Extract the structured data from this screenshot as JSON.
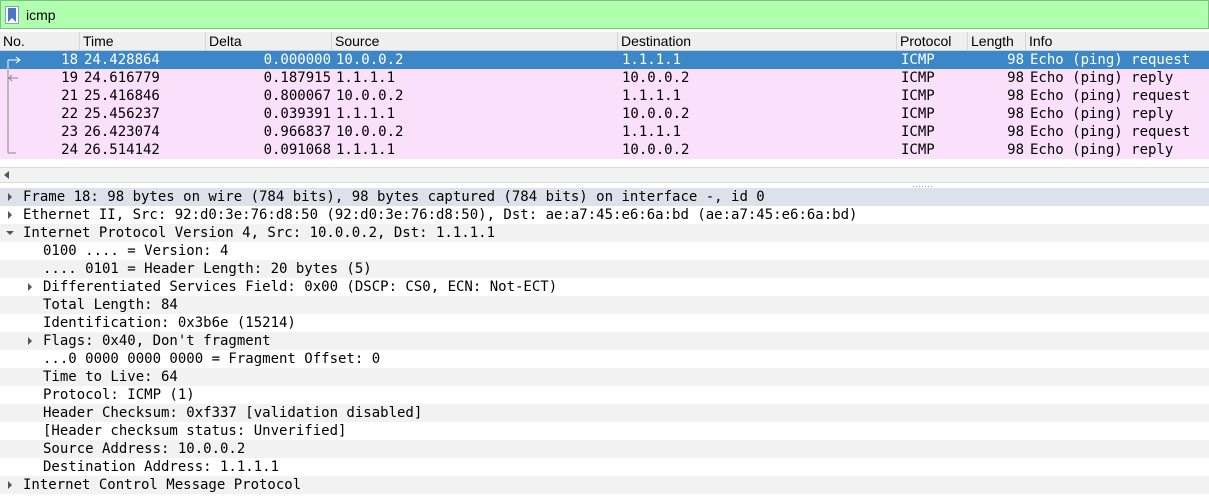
{
  "filter": {
    "value": "icmp",
    "background": "#afffaf"
  },
  "columns": [
    "No.",
    "Time",
    "Delta",
    "Source",
    "Destination",
    "Protocol",
    "Length",
    "Info"
  ],
  "packets": [
    {
      "no": "18",
      "time": "24.428864",
      "delta": "0.000000",
      "source": "10.0.0.2",
      "destination": "1.1.1.1",
      "protocol": "ICMP",
      "length": "98",
      "info": "Echo (ping) request"
    },
    {
      "no": "19",
      "time": "24.616779",
      "delta": "0.187915",
      "source": "1.1.1.1",
      "destination": "10.0.0.2",
      "protocol": "ICMP",
      "length": "98",
      "info": "Echo (ping) reply"
    },
    {
      "no": "21",
      "time": "25.416846",
      "delta": "0.800067",
      "source": "10.0.0.2",
      "destination": "1.1.1.1",
      "protocol": "ICMP",
      "length": "98",
      "info": "Echo (ping) request"
    },
    {
      "no": "22",
      "time": "25.456237",
      "delta": "0.039391",
      "source": "1.1.1.1",
      "destination": "10.0.0.2",
      "protocol": "ICMP",
      "length": "98",
      "info": "Echo (ping) reply"
    },
    {
      "no": "23",
      "time": "26.423074",
      "delta": "0.966837",
      "source": "10.0.0.2",
      "destination": "1.1.1.1",
      "protocol": "ICMP",
      "length": "98",
      "info": "Echo (ping) request"
    },
    {
      "no": "24",
      "time": "26.514142",
      "delta": "0.091068",
      "source": "1.1.1.1",
      "destination": "10.0.0.2",
      "protocol": "ICMP",
      "length": "98",
      "info": "Echo (ping) reply"
    }
  ],
  "selected_packet": "18",
  "colors": {
    "row_icmp": "#fbe0fb",
    "row_selected": "#3b87c8"
  },
  "details": [
    {
      "text": "Frame 18: 98 bytes on wire (784 bits), 98 bytes captured (784 bits) on interface -, id 0",
      "expander": "collapsed"
    },
    {
      "text": "Ethernet II, Src: 92:d0:3e:76:d8:50 (92:d0:3e:76:d8:50), Dst: ae:a7:45:e6:6a:bd (ae:a7:45:e6:6a:bd)",
      "expander": "collapsed"
    },
    {
      "text": "Internet Protocol Version 4, Src: 10.0.0.2, Dst: 1.1.1.1",
      "expander": "expanded"
    },
    {
      "text": "0100 .... = Version: 4",
      "expander": "none"
    },
    {
      "text": ".... 0101 = Header Length: 20 bytes (5)",
      "expander": "none"
    },
    {
      "text": "Differentiated Services Field: 0x00 (DSCP: CS0, ECN: Not-ECT)",
      "expander": "collapsed"
    },
    {
      "text": "Total Length: 84",
      "expander": "none"
    },
    {
      "text": "Identification: 0x3b6e (15214)",
      "expander": "none"
    },
    {
      "text": "Flags: 0x40, Don't fragment",
      "expander": "collapsed"
    },
    {
      "text": "...0 0000 0000 0000 = Fragment Offset: 0",
      "expander": "none"
    },
    {
      "text": "Time to Live: 64",
      "expander": "none"
    },
    {
      "text": "Protocol: ICMP (1)",
      "expander": "none"
    },
    {
      "text": "Header Checksum: 0xf337 [validation disabled]",
      "expander": "none"
    },
    {
      "text": "[Header checksum status: Unverified]",
      "expander": "none"
    },
    {
      "text": "Source Address: 10.0.0.2",
      "expander": "none"
    },
    {
      "text": "Destination Address: 1.1.1.1",
      "expander": "none"
    },
    {
      "text": "Internet Control Message Protocol",
      "expander": "collapsed"
    }
  ]
}
